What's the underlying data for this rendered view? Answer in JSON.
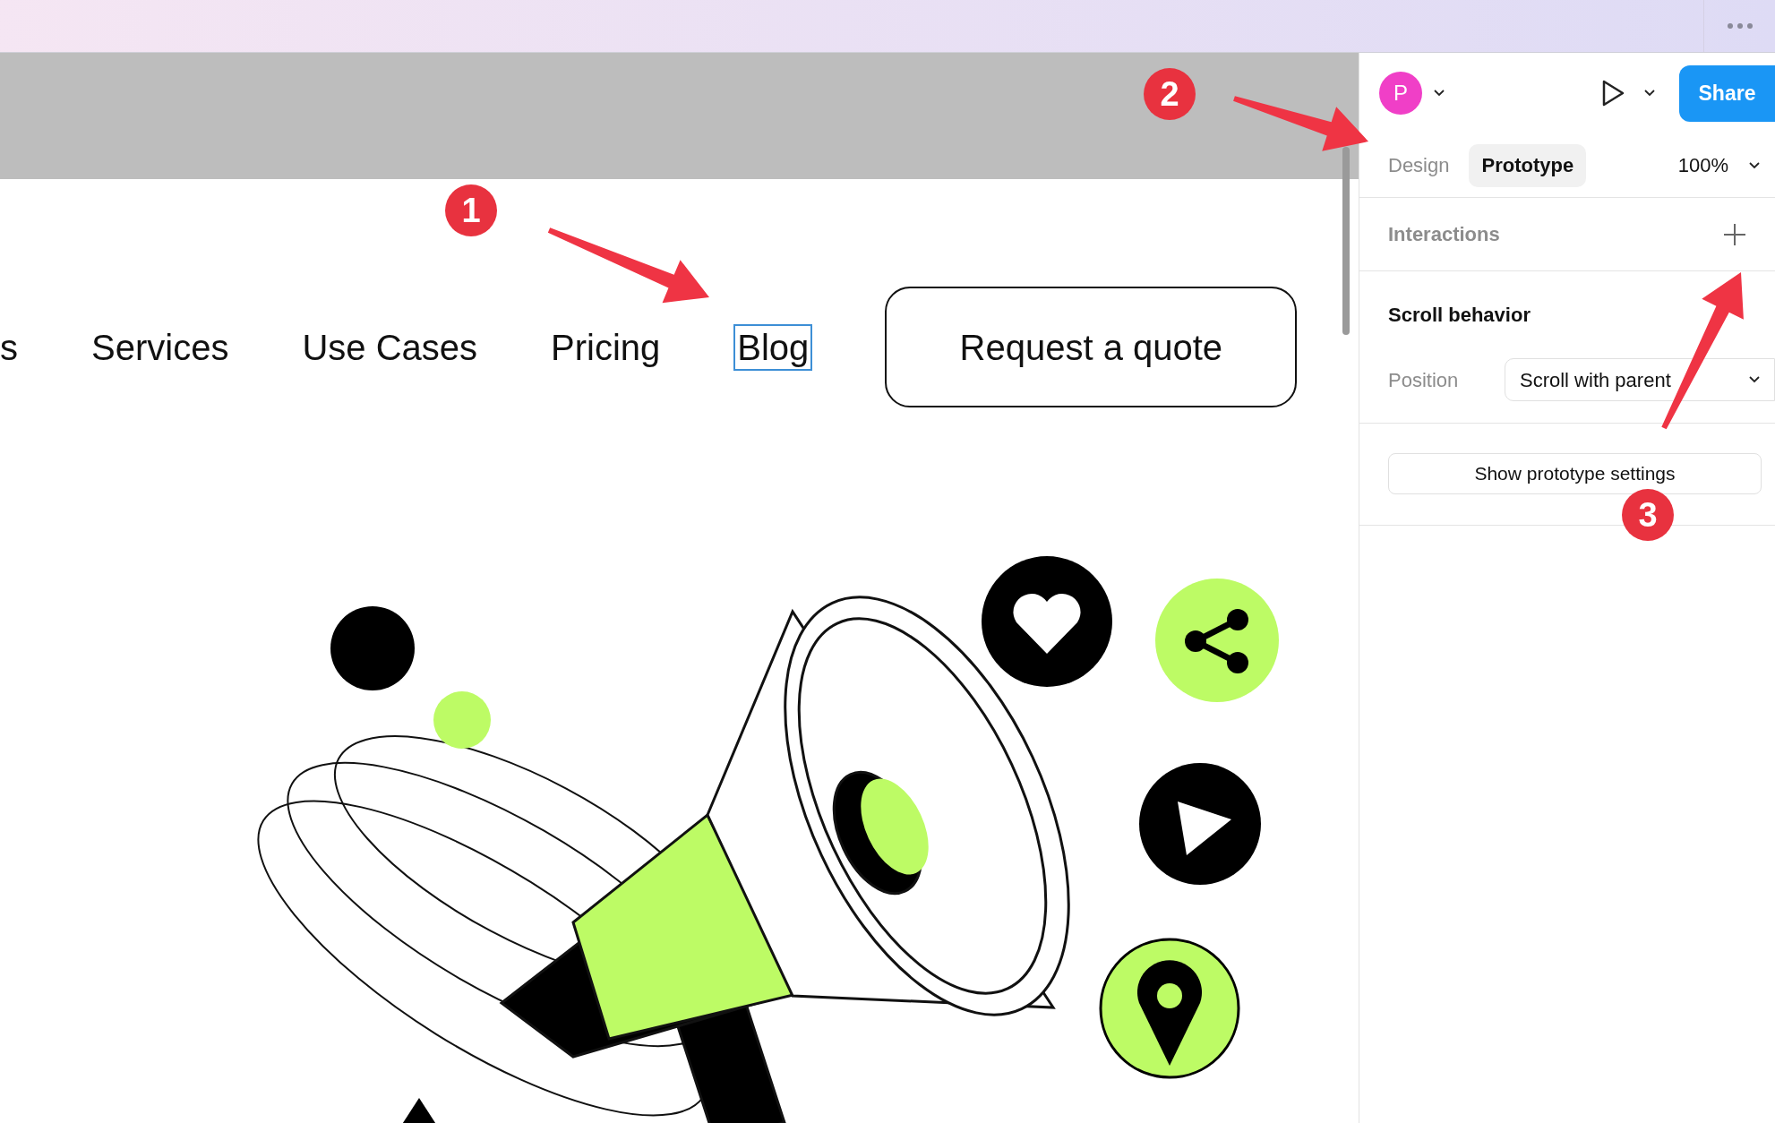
{
  "canvas": {
    "nav": {
      "items": [
        {
          "label": "s",
          "selected": false
        },
        {
          "label": "Services",
          "selected": false
        },
        {
          "label": "Use Cases",
          "selected": false
        },
        {
          "label": "Pricing",
          "selected": false
        },
        {
          "label": "Blog",
          "selected": true
        }
      ],
      "cta": "Request a quote"
    }
  },
  "panel": {
    "avatar": "P",
    "share": "Share",
    "tabs": [
      {
        "label": "Design",
        "selected": false
      },
      {
        "label": "Prototype",
        "selected": true
      }
    ],
    "zoom": "100%",
    "interactions": {
      "title": "Interactions"
    },
    "scroll_behavior": {
      "title": "Scroll behavior",
      "position_label": "Position",
      "position_value": "Scroll with parent"
    },
    "settings_button": "Show prototype settings"
  },
  "annotations": [
    {
      "label": "1"
    },
    {
      "label": "2"
    },
    {
      "label": "3"
    }
  ]
}
